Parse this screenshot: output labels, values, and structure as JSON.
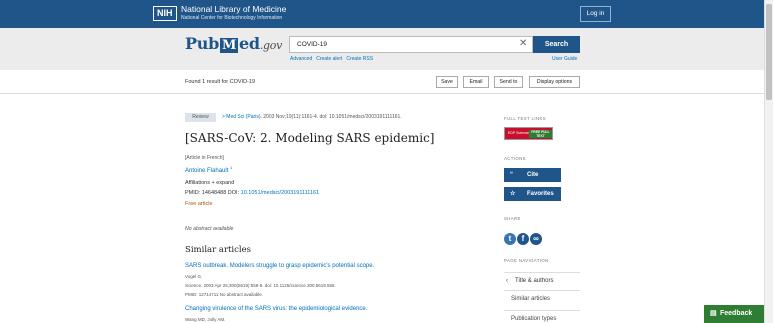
{
  "nih": {
    "logo": "NIH",
    "title": "National Library of Medicine",
    "subtitle": "National Center for Biotechnology Information",
    "login": "Log in"
  },
  "search": {
    "logo_pub": "Pub",
    "logo_m": "M",
    "logo_ed": "ed",
    "logo_gov": ".gov",
    "query": "COVID-19",
    "clear": "✕",
    "button": "Search",
    "links": [
      "Advanced",
      "Create alert",
      "Create RSS"
    ],
    "user_guide": "User Guide"
  },
  "results": {
    "found": "Found 1 result for COVID-19",
    "actions": [
      "Save",
      "Email",
      "Send to",
      "Display options"
    ]
  },
  "article": {
    "badge": "Review",
    "journal": "> Med Sci (Paris).",
    "citation": " 2003 Nov;19(11):1161-4. doi: 10.1051/medsci/2003191111161.",
    "title": "[SARS-CoV: 2. Modeling SARS epidemic]",
    "language_note": "[Article in French]",
    "author": "Antoine Flahault",
    "author_sup": "1",
    "affiliations": "Affiliations  +  expand",
    "pmid": "PMID: 14648488   DOI: ",
    "doi": "10.1051/medsci/2003191111161",
    "free": "Free article",
    "no_abstract": "No abstract available"
  },
  "similar": {
    "heading": "Similar articles",
    "items": [
      {
        "title": "SARS outbreak. Modelers struggle to grasp epidemic's potential scope.",
        "author": "Vogel G.",
        "source": "Science. 2003 Apr 25;300(5619):558-9. doi: 10.1126/science.300.5619.558.",
        "pmid": "PMID: 12714711     No abstract available."
      },
      {
        "title": "Changing virulence of the SARS virus: the epidemiological evidence.",
        "author": "Wang MD, Jolly AM."
      }
    ]
  },
  "sidebar": {
    "full_text_label": "FULL TEXT LINKS",
    "full_text_left": "EDP Sciences",
    "full_text_right": "FREE FULL TEXT",
    "actions_label": "ACTIONS",
    "cite_icon": "“",
    "cite": "Cite",
    "favorites_icon": "☆",
    "favorites": "Favorites",
    "share_label": "SHARE",
    "share_icons": [
      "twitter-icon",
      "facebook-icon",
      "link-icon"
    ],
    "page_nav_label": "PAGE NAVIGATION",
    "nav": [
      "Title & authors",
      "Similar articles",
      "Publication types"
    ]
  },
  "feedback": "Feedback",
  "colors": {
    "nih_blue": "#20558a",
    "link_blue": "#0071bc",
    "free_orange": "#b35309",
    "feedback_green": "#2e7d32"
  }
}
